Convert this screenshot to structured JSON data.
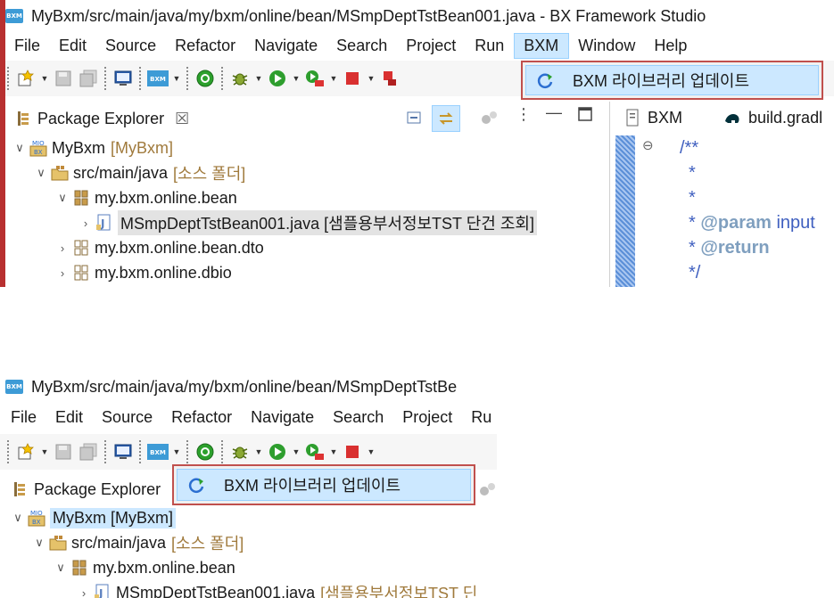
{
  "window": {
    "title": "MyBxm/src/main/java/my/bxm/online/bean/MSmpDeptTstBean001.java - BX Framework Studio",
    "title_truncated": "MyBxm/src/main/java/my/bxm/online/bean/MSmpDeptTstBe",
    "logo_text": "BXM"
  },
  "menu": {
    "items": [
      {
        "label": "File"
      },
      {
        "label": "Edit"
      },
      {
        "label": "Source"
      },
      {
        "label": "Refactor"
      },
      {
        "label": "Navigate"
      },
      {
        "label": "Search"
      },
      {
        "label": "Project"
      },
      {
        "label": "Run"
      },
      {
        "label": "BXM"
      },
      {
        "label": "Window"
      },
      {
        "label": "Help"
      }
    ],
    "truncated_last": "Ru"
  },
  "toolbar": {
    "bxm_button_text": "BXM"
  },
  "bxm_menu": {
    "library_update": "BXM 라이브러리 업데이트"
  },
  "package_explorer": {
    "title": "Package Explorer",
    "close_symbol": "☒",
    "tree": {
      "project": "MyBxm",
      "project_deco": "[MyBxm]",
      "source_folder": "src/main/java",
      "source_folder_deco": "[소스 폴더]",
      "package_bean": "my.bxm.online.bean",
      "file_name": "MSmpDeptTstBean001.java",
      "file_deco": "[샘플용부서정보TST 단건 조회]",
      "file_deco_partial": "[샘플용부서정보TST 딘",
      "package_dto": "my.bxm.online.bean.dto",
      "package_dbio": "my.bxm.online.dbio"
    }
  },
  "editor": {
    "tabs": [
      "BXM",
      "build.gradle"
    ],
    "tab_bxm": "BXM",
    "tab_gradle": "build.gradl",
    "fold_symbol": "⊖",
    "lines": {
      "l1": "/**",
      "l2": "*",
      "l3": "*",
      "l4_kw": "@param",
      "l4_rest": " input",
      "l5_kw": "@return",
      "l6": "*/"
    },
    "star": "*"
  },
  "colors": {
    "highlight_border": "#c0504d",
    "menu_highlight": "#cce8ff",
    "bxm_logo": "#3d9bd6",
    "decoration_text": "#a07a3c",
    "javadoc": "#3f5fbf",
    "javadoc_tag": "#7f9fbf"
  }
}
